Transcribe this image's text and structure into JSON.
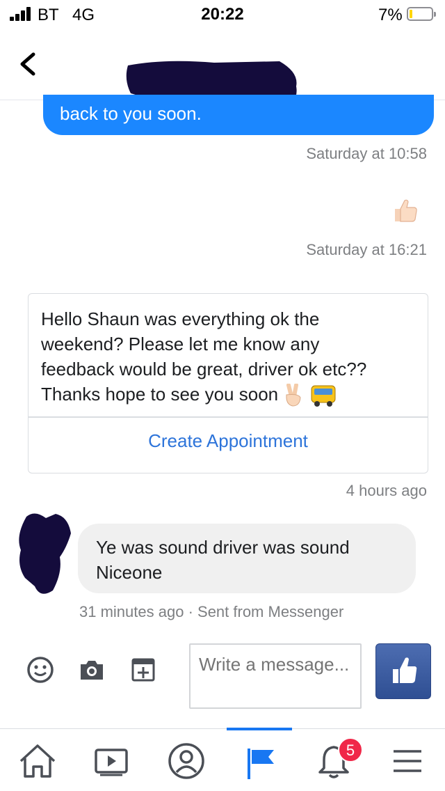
{
  "status_bar": {
    "carrier": "BT",
    "network": "4G",
    "time": "20:22",
    "battery_percent": "7%",
    "battery_level": 0.07
  },
  "header": {
    "back_icon": "chevron-left-icon",
    "title_redacted": true
  },
  "thread": {
    "outgoing_message_tail": "back to you soon.",
    "timestamp_1": "Saturday at 10:58",
    "reaction_icon": "thumbs-up-icon",
    "timestamp_2": "Saturday at 16:21",
    "card": {
      "lines": [
        "Hello Shaun was everything ok the",
        "weekend? Please let me know any",
        "feedback would be great, driver ok etc??",
        "Thanks hope to see you soon"
      ],
      "emoji_icons": [
        "victory-hand-icon",
        "bus-icon"
      ],
      "action_label": "Create Appointment"
    },
    "timestamp_3": "4 hours ago",
    "incoming_message": {
      "lines": [
        "Ye was sound driver was sound",
        "Niceone"
      ],
      "time": "31 minutes ago",
      "separator": "·",
      "source": "Sent from Messenger"
    }
  },
  "composer": {
    "placeholder": "Write a message...",
    "icons": [
      "emoji-icon",
      "camera-icon",
      "add-media-icon"
    ],
    "send_icon": "like-icon"
  },
  "tab_bar": {
    "active_tab": "pages",
    "notification_badge": "5",
    "colors": {
      "active": "#1877f2",
      "badge": "#f02849"
    }
  },
  "colors": {
    "outgoing_bubble": "#1b87ff",
    "incoming_bubble": "#f0f0f0",
    "link": "#2d74da",
    "like_button": "#3b5998",
    "redaction": "#140c3c"
  }
}
